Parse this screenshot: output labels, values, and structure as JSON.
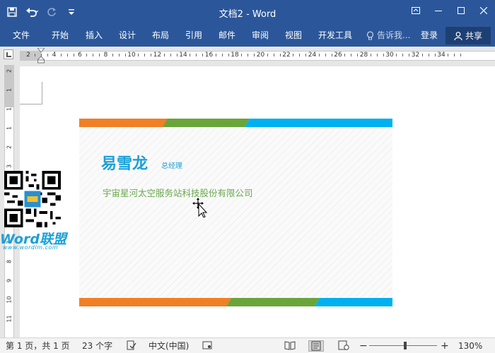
{
  "window": {
    "title": "文档2 - Word"
  },
  "ribbon": {
    "tabs": [
      "文件",
      "开始",
      "插入",
      "设计",
      "布局",
      "引用",
      "邮件",
      "审阅",
      "视图",
      "开发工具"
    ],
    "tell_me": "告诉我...",
    "sign_in": "登录",
    "share": "共享"
  },
  "ruler": {
    "h_labels": [
      "2",
      "4",
      "6",
      "8",
      "10",
      "12",
      "14",
      "16",
      "18",
      "20",
      "22",
      "24",
      "26",
      "28",
      "30",
      "32",
      "34"
    ],
    "v_labels": [
      "2",
      "1",
      "1",
      "1",
      "2",
      "3",
      "4",
      "5",
      "6",
      "7",
      "8",
      "9",
      "10",
      "11"
    ]
  },
  "card": {
    "name": "易雪龙",
    "role": "总经理",
    "company": "宇宙星河太空服务站科技股份有限公司",
    "colors": {
      "orange": "#f07f26",
      "green": "#6aa53a",
      "blue": "#00b0f0",
      "name": "#1aa0d8",
      "company": "#6aa84f"
    }
  },
  "watermark": {
    "brand_en": "Word",
    "brand_cn": "联盟",
    "url": "www.wordlm.com"
  },
  "status": {
    "page": "第 1 页，共 1 页",
    "words": "23 个字",
    "language": "中文(中国)",
    "zoom": "130%"
  },
  "theme": {
    "ribbon_blue": "#2b579a"
  }
}
